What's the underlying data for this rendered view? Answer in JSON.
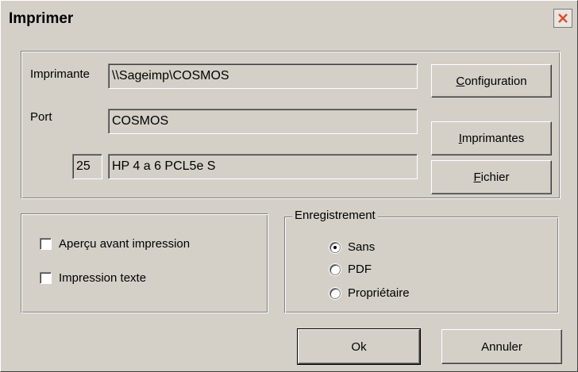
{
  "window": {
    "title": "Imprimer",
    "close_icon": "close-icon",
    "close_color": "#e04a2a"
  },
  "printer": {
    "imprimante_label": "Imprimante",
    "imprimante_value": "\\\\Sageimp\\COSMOS",
    "port_label": "Port",
    "port_value": "COSMOS",
    "code_value": "25",
    "model_value": "HP 4 a 6   PCL5e   S"
  },
  "buttons": {
    "configuration_first": "C",
    "configuration_rest": "onfiguration",
    "imprimantes_first": "I",
    "imprimantes_rest": "mprimantes",
    "fichier_first": "F",
    "fichier_rest": "ichier",
    "ok": "Ok",
    "annuler": "Annuler"
  },
  "options": {
    "apercu": {
      "label": "Aperçu avant impression",
      "checked": false
    },
    "texte": {
      "label": "Impression texte",
      "checked": false
    }
  },
  "enregistrement": {
    "legend": "Enregistrement",
    "options": [
      {
        "label": "Sans",
        "checked": true
      },
      {
        "label": "PDF",
        "checked": false
      },
      {
        "label": "Propriétaire",
        "checked": false
      }
    ]
  }
}
